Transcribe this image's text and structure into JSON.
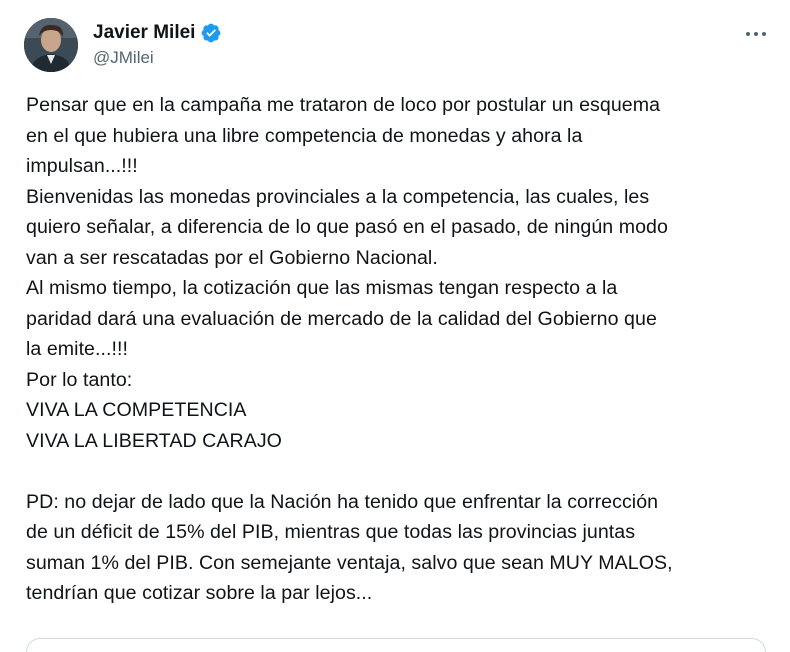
{
  "author": {
    "display_name": "Javier Milei",
    "handle": "@JMilei",
    "verified": true,
    "verified_color": "#1d9bf0"
  },
  "icons": {
    "avatar": "profile-photo",
    "verified": "verified-badge-icon",
    "more": "more-options-icon"
  },
  "tweet": {
    "lines": [
      "Pensar que en la campaña me trataron de loco por postular un esquema",
      "en el que hubiera una libre competencia de monedas y ahora la",
      "impulsan...!!!",
      "Bienvenidas las monedas provinciales a la competencia, las cuales, les",
      "quiero señalar, a diferencia de lo que pasó en el pasado, de ningún modo",
      "van a ser rescatadas por el Gobierno Nacional.",
      "Al mismo tiempo, la cotización que las mismas tengan respecto a la",
      "paridad dará una evaluación de mercado de la calidad del Gobierno que",
      "la emite...!!!",
      "Por lo tanto:",
      "VIVA LA COMPETENCIA",
      "VIVA LA LIBERTAD CARAJO",
      "",
      "PD: no dejar de lado que la Nación ha tenido que enfrentar la corrección",
      "de un déficit de 15% del PIB, mientras que todas las provincias juntas",
      "suman 1% del PIB. Con semejante ventaja, salvo que sean MUY MALOS,",
      "tendrían que cotizar sobre la par lejos..."
    ]
  }
}
